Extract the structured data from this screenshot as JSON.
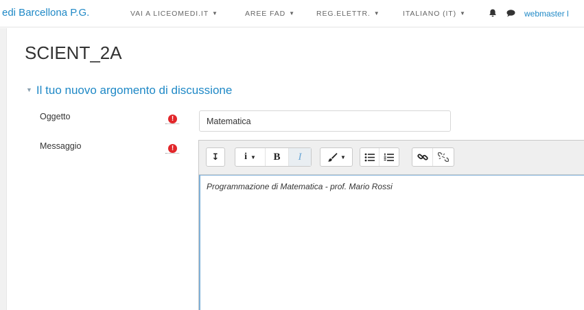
{
  "navbar": {
    "brand": "edi Barcellona P.G.",
    "items": [
      {
        "label": "VAI A LICEOMEDI.IT"
      },
      {
        "label": "AREE FAD"
      },
      {
        "label": "REG.ELETTR."
      },
      {
        "label": "ITALIANO (IT)"
      }
    ],
    "caret": "▼",
    "icons": [
      "bell-icon",
      "chat-icon"
    ],
    "user": "webmaster l"
  },
  "page": {
    "title": "SCIENT_2A"
  },
  "form": {
    "section_toggle": "▼",
    "section_title": "Il tuo nuovo argomento di discussione",
    "subject_label": "Oggetto",
    "subject_value": "Matematica",
    "message_label": "Messaggio",
    "required_mark": "!",
    "message_text": "Programmazione di Matematica - prof. Mario Rossi"
  },
  "toolbar": {
    "collapse_label": "↧",
    "info_label": "i",
    "bold_label": "B",
    "italic_label": "I",
    "caret": "▼"
  },
  "colors": {
    "accent": "#1e88c6",
    "required": "#e2262a"
  }
}
